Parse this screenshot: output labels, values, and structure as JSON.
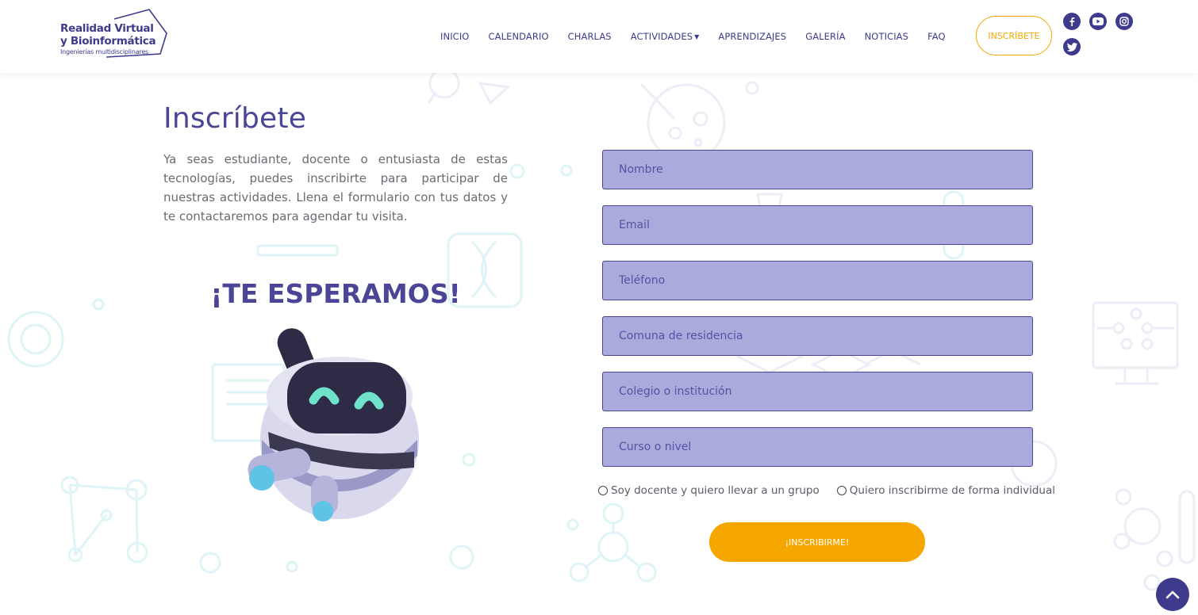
{
  "brand": {
    "line1": "Realidad Virtual",
    "line2": "y Bioinformática",
    "line3": "Ingenierías multidisciplinares",
    "color": "#3e3b8c"
  },
  "nav": {
    "items": [
      {
        "label": "INICIO"
      },
      {
        "label": "CALENDARIO"
      },
      {
        "label": "CHARLAS"
      },
      {
        "label": "ACTIVIDADES",
        "has_dropdown": true
      },
      {
        "label": "APRENDIZAJES"
      },
      {
        "label": "GALERÍA"
      },
      {
        "label": "NOTICIAS"
      },
      {
        "label": "FAQ"
      }
    ],
    "cta_label": "INSCRÍBETE"
  },
  "social": [
    "facebook-icon",
    "youtube-icon",
    "instagram-icon",
    "twitter-icon"
  ],
  "main": {
    "title": "Inscríbete",
    "intro": "Ya seas estudiante, docente o entusiasta de estas tecnologías, puedes inscribirte para participar de nuestras actividades. Llena el formulario con tus datos y te contactaremos para agendar tu visita.",
    "tagline": "¡TE ESPERAMOS!"
  },
  "form": {
    "fields": [
      {
        "placeholder": "Nombre",
        "value": ""
      },
      {
        "placeholder": "Email",
        "value": ""
      },
      {
        "placeholder": "Teléfono",
        "value": ""
      },
      {
        "placeholder": "Comuna de residencia",
        "value": ""
      },
      {
        "placeholder": "Colegio o institución",
        "value": ""
      },
      {
        "placeholder": "Curso o nivel",
        "value": ""
      }
    ],
    "radio_options": [
      {
        "label": "Soy docente y quiero llevar a un grupo",
        "selected": false
      },
      {
        "label": "Quiero inscribirme de forma individual",
        "selected": false
      }
    ],
    "submit_label": "¡INSCRIBIRME!"
  },
  "colors": {
    "primary": "#4a4596",
    "accent": "#f5a700",
    "field_bg": "#aaaadc"
  }
}
